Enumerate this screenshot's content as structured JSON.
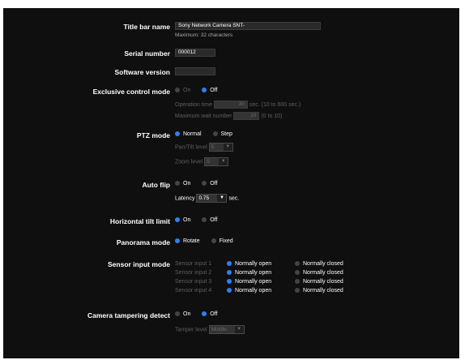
{
  "title_bar": {
    "label": "Title bar name",
    "value": "Sony Network Camera SNT-",
    "note": "Maximum: 32 characters"
  },
  "serial": {
    "label": "Serial number",
    "value": "000012"
  },
  "software": {
    "label": "Software version",
    "value": ""
  },
  "exclusive": {
    "label": "Exclusive control mode",
    "on": "On",
    "off": "Off",
    "selected": "Off",
    "op_time_label": "Operation time",
    "op_time_value": "30",
    "op_time_suffix": "sec. (10 to 600 sec.)",
    "max_wait_label": "Maximum wait number",
    "max_wait_value": "10",
    "max_wait_suffix": "(0 to 10)"
  },
  "ptz": {
    "label": "PTZ mode",
    "normal": "Normal",
    "step": "Step",
    "selected": "Normal",
    "pan_tilt_label": "Pan/Tilt level",
    "pan_tilt_value": "5",
    "zoom_label": "Zoom level",
    "zoom_value": "5"
  },
  "auto_flip": {
    "label": "Auto flip",
    "on": "On",
    "off": "Off",
    "selected": "none",
    "latency_label": "Latency",
    "latency_value": "0.75",
    "latency_suffix": "sec."
  },
  "h_tilt": {
    "label": "Horizontal tilt limit",
    "on": "On",
    "off": "Off",
    "selected": "On"
  },
  "panorama": {
    "label": "Panorama mode",
    "rotate": "Rotate",
    "fixed": "Fixed",
    "selected": "Rotate"
  },
  "sensor": {
    "label": "Sensor input mode",
    "inputs": [
      {
        "name": "Sensor input 1",
        "open": "Normally open",
        "closed": "Normally closed",
        "selected": "open"
      },
      {
        "name": "Sensor input 2",
        "open": "Normally open",
        "closed": "Normally closed",
        "selected": "open"
      },
      {
        "name": "Sensor input 3",
        "open": "Normally open",
        "closed": "Normally closed",
        "selected": "open"
      },
      {
        "name": "Sensor input 4",
        "open": "Normally open",
        "closed": "Normally closed",
        "selected": "open"
      }
    ]
  },
  "tamper": {
    "label": "Camera tampering detect",
    "on": "On",
    "off": "Off",
    "selected": "Off",
    "level_label": "Tamper level",
    "level_value": "Middle"
  },
  "colors": {
    "background": "#0f0f0f",
    "accent": "#2f7ef5",
    "text": "#ffffff",
    "disabled_text": "#5f5f5f",
    "note_text": "#a8a8a8"
  }
}
